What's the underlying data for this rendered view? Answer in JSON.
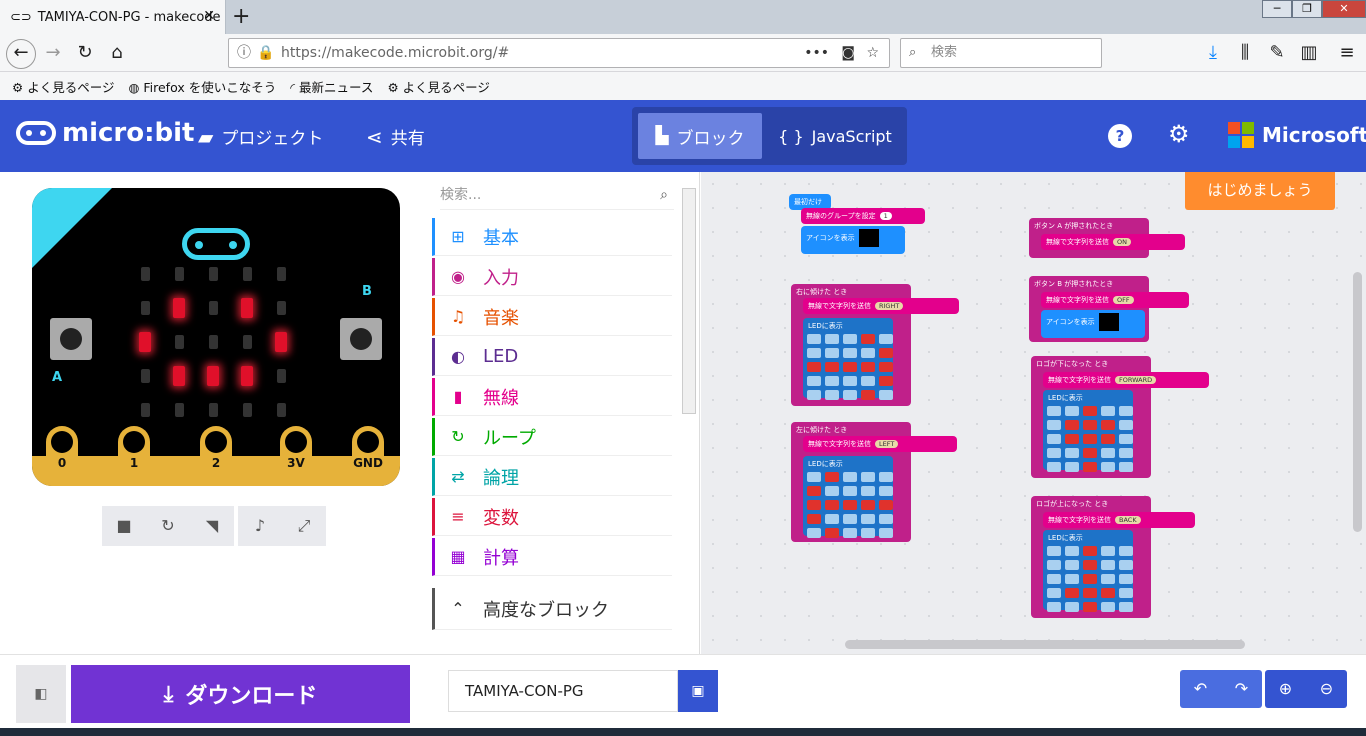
{
  "browser": {
    "tab_title": "TAMIYA-CON-PG - makecode",
    "tab_close": "✕",
    "new_tab": "+",
    "url": "https://makecode.microbit.org/#",
    "search_placeholder": "検索",
    "bookmarks": [
      "よく見るページ",
      "Firefox を使いこなそう",
      "最新ニュース",
      "よく見るページ"
    ]
  },
  "header": {
    "logo_text": "micro:bit",
    "projects_label": "プロジェクト",
    "share_label": "共有",
    "blocks_label": "ブロック",
    "javascript_label": "JavaScript",
    "microsoft_label": "Microsoft",
    "help_symbol": "?",
    "settings_symbol": "⚙"
  },
  "simulator": {
    "pins": [
      "0",
      "1",
      "2",
      "3V",
      "GND"
    ],
    "button_a": "A",
    "button_b": "B",
    "led_on": [
      [
        1,
        1
      ],
      [
        1,
        3
      ],
      [
        2,
        0
      ],
      [
        2,
        4
      ],
      [
        3,
        1
      ],
      [
        3,
        2
      ],
      [
        3,
        3
      ]
    ]
  },
  "toolbox": {
    "search_placeholder": "検索...",
    "categories": [
      {
        "label": "基本",
        "color": "#1e90ff",
        "icon": "⊞"
      },
      {
        "label": "入力",
        "color": "#c0208a",
        "icon": "◉"
      },
      {
        "label": "音楽",
        "color": "#e65100",
        "icon": "♫"
      },
      {
        "label": "LED",
        "color": "#5c2d91",
        "icon": "◐"
      },
      {
        "label": "無線",
        "color": "#e3008c",
        "icon": "▮"
      },
      {
        "label": "ループ",
        "color": "#00aa00",
        "icon": "↻"
      },
      {
        "label": "論理",
        "color": "#00a4a6",
        "icon": "⇄"
      },
      {
        "label": "変数",
        "color": "#dc143c",
        "icon": "≡"
      },
      {
        "label": "計算",
        "color": "#9400d3",
        "icon": "▦"
      }
    ],
    "advanced_label": "高度なブロック"
  },
  "workspace": {
    "start_button": "はじめましょう",
    "blocks": {
      "on_start": "最初だけ",
      "set_group": "無線のグループを設定",
      "group_value": "1",
      "show_icon": "アイコンを表示",
      "tilt_right": "右に傾けた",
      "tilt_left": "左に傾けた",
      "when": "とき",
      "send_string": "無線で文字列を送信",
      "show_leds": "LEDに表示",
      "right": "RIGHT",
      "left": "LEFT",
      "button_a_pressed": "ボタン A が押されたとき",
      "button_b_pressed": "ボタン B が押されたとき",
      "on": "ON",
      "off": "OFF",
      "logo_down": "ロゴが下になった",
      "logo_up": "ロゴが上になった",
      "forward": "FORWARD",
      "back": "BACK"
    }
  },
  "bottom": {
    "download_label": "ダウンロード",
    "project_name": "TAMIYA-CON-PG"
  }
}
